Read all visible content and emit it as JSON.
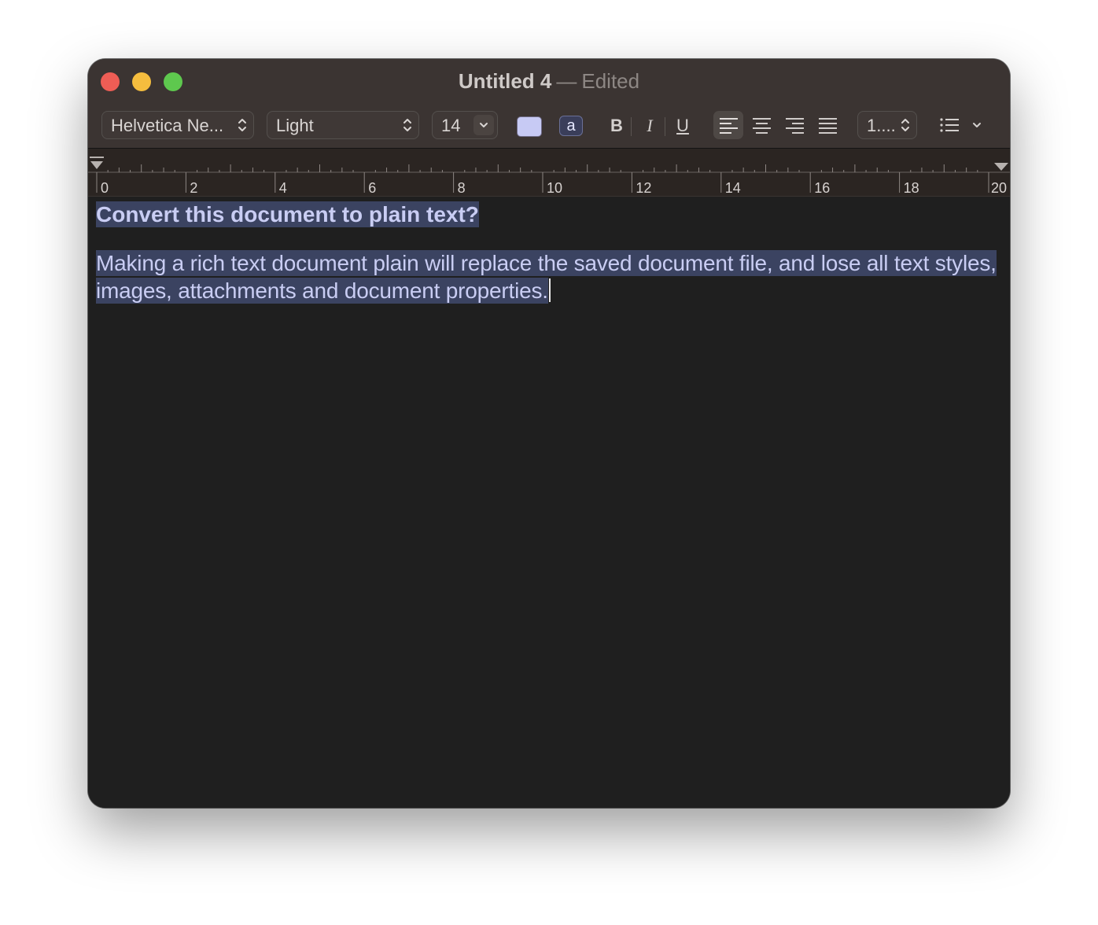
{
  "window": {
    "title": "Untitled 4",
    "separator": "—",
    "status": "Edited"
  },
  "toolbar": {
    "font_family": "Helvetica Ne...",
    "font_style": "Light",
    "font_size": "14",
    "text_color": "#c7caf4",
    "background_label": "a",
    "bold_label": "B",
    "italic_label": "I",
    "underline_label": "U",
    "alignment_active": "left",
    "line_spacing": "1...."
  },
  "ruler": {
    "labels": [
      "0",
      "2",
      "4",
      "6",
      "8",
      "10",
      "12",
      "14",
      "16",
      "18",
      "20"
    ]
  },
  "document": {
    "heading": "Convert this document to plain text?",
    "line1": "Making a rich text document plain will replace the saved document file, and lose all text styles,",
    "line2": "images, attachments and document properties."
  },
  "colors": {
    "accent_text": "#c9cdf3",
    "selection": "#3b4361",
    "titlebar": "#3b3432",
    "editor_bg": "#1f1f1f"
  }
}
